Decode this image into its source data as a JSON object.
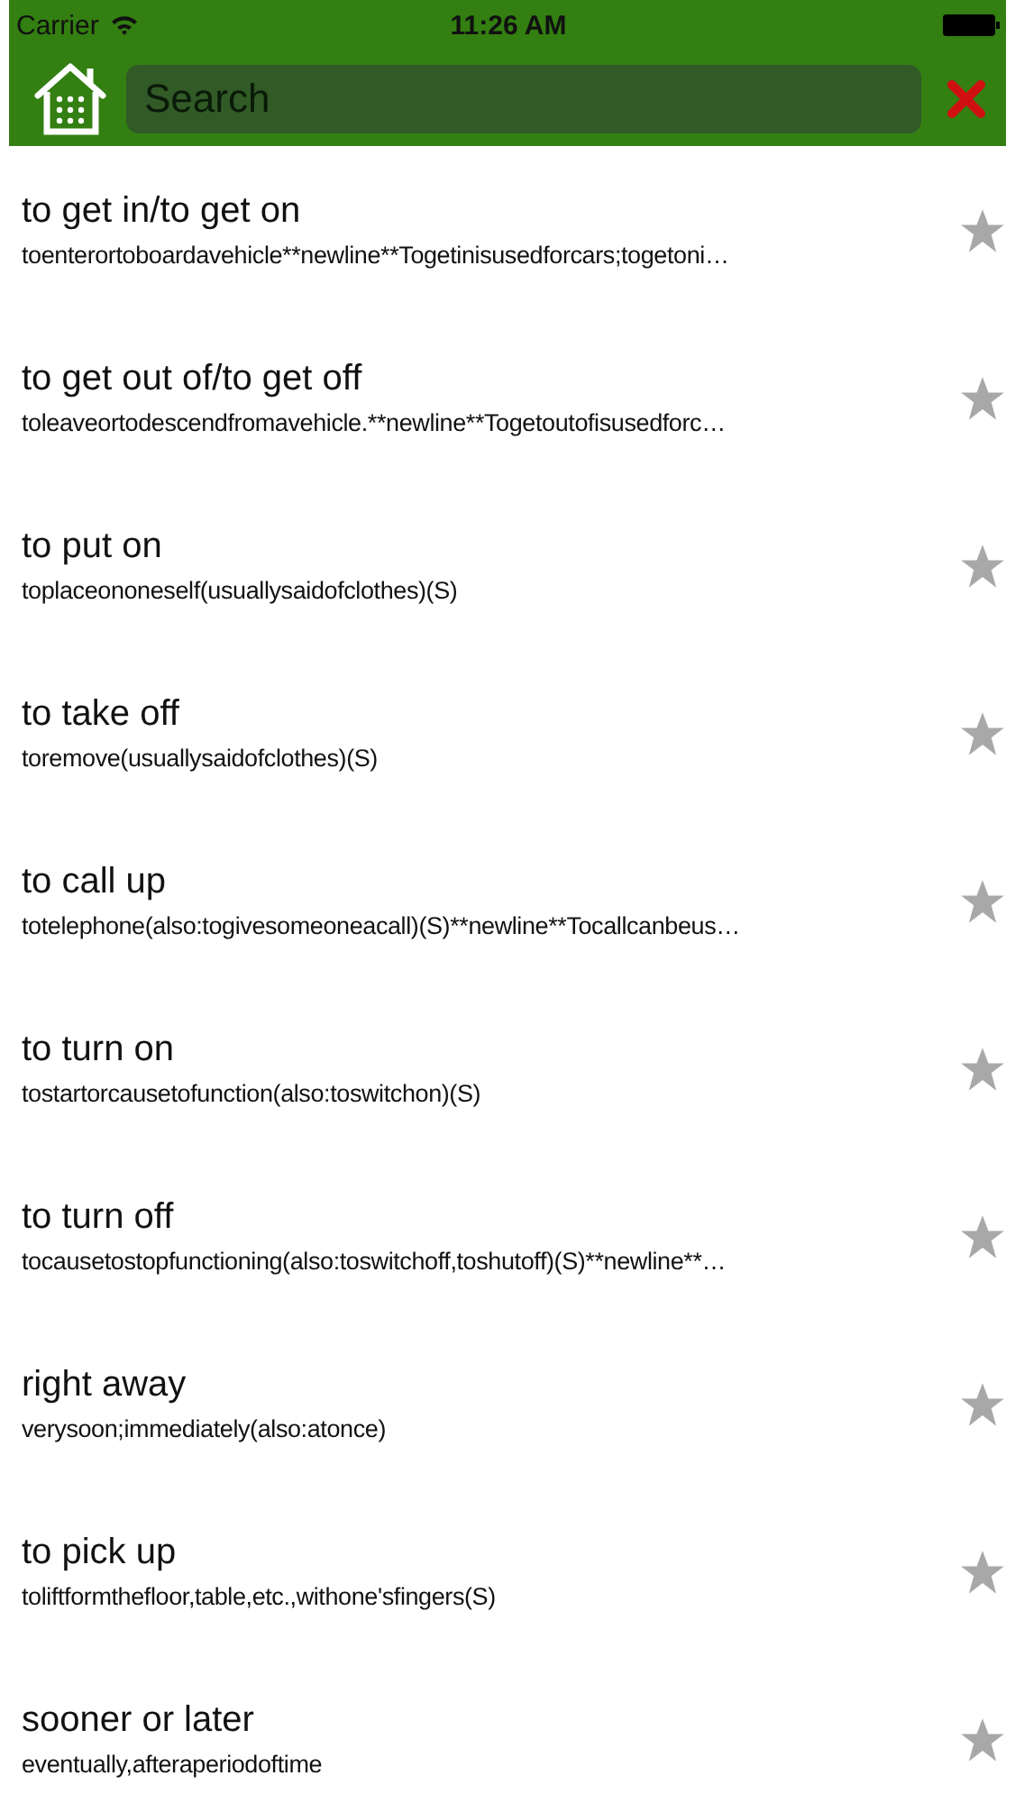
{
  "status_bar": {
    "carrier": "Carrier",
    "time": "11:26 AM"
  },
  "search": {
    "placeholder": "Search"
  },
  "entries": [
    {
      "title": "to get in/to get on",
      "description": "toenterortoboardavehicle**newline**Togetinisusedforcars;togetoni…",
      "favorite": false
    },
    {
      "title": "to get out of/to get off",
      "description": "toleaveortodescendfromavehicle.**newline**Togetoutofisusedforc…",
      "favorite": false
    },
    {
      "title": "to put on",
      "description": "toplaceononeself(usuallysaidofclothes)(S)",
      "favorite": false
    },
    {
      "title": "to take off",
      "description": "toremove(usuallysaidofclothes)(S)",
      "favorite": false
    },
    {
      "title": "to call up",
      "description": "totelephone(also:togivesomeoneacall)(S)**newline**Tocallcanbeus…",
      "favorite": false
    },
    {
      "title": "to turn on",
      "description": "tostartorcausetofunction(also:toswitchon)(S)",
      "favorite": false
    },
    {
      "title": "to turn off",
      "description": "tocausetostopfunctioning(also:toswitchoff,toshutoff)(S)**newline**…",
      "favorite": false
    },
    {
      "title": "right away",
      "description": "verysoon;immediately(also:atonce)",
      "favorite": false
    },
    {
      "title": "to pick up",
      "description": "toliftformthefloor,table,etc.,withone'sfingers(S)",
      "favorite": false
    },
    {
      "title": "sooner or later",
      "description": "eventually,afteraperiodoftime",
      "favorite": false
    }
  ]
}
